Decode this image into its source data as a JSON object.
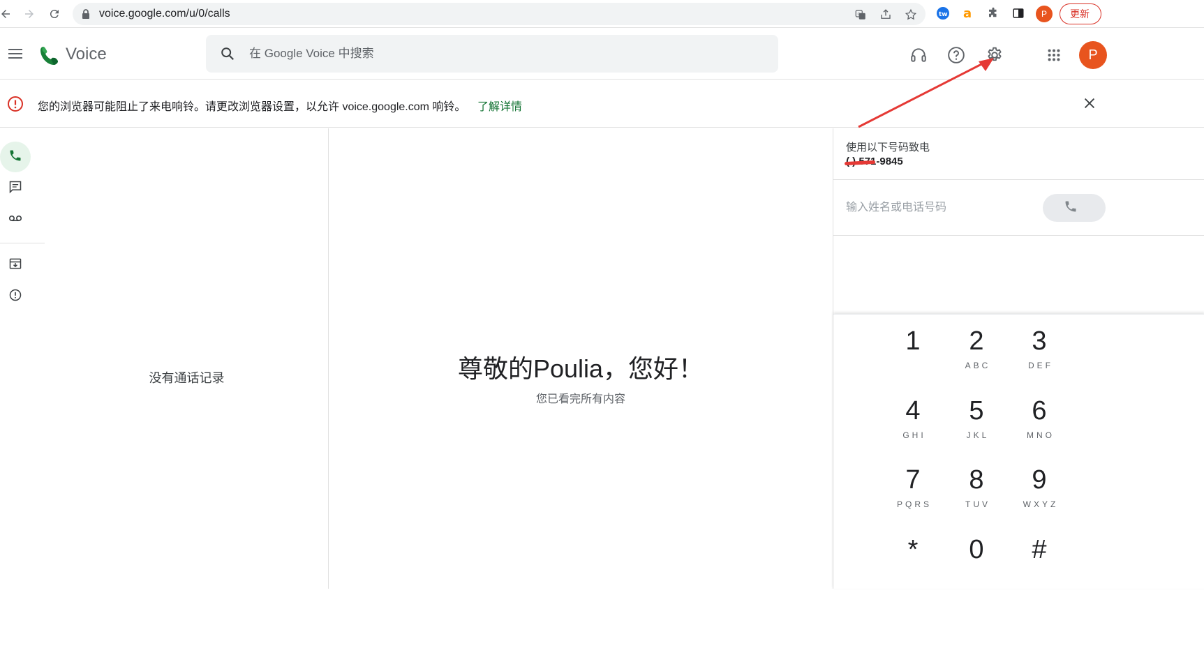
{
  "browser": {
    "url": "voice.google.com/u/0/calls",
    "profile_initial": "P",
    "update_label": "更新"
  },
  "header": {
    "app_title": "Voice",
    "search_placeholder": "在 Google Voice 中搜索",
    "avatar_initial": "P"
  },
  "banner": {
    "message": "您的浏览器可能阻止了来电响铃。请更改浏览器设置，以允许 voice.google.com 响铃。",
    "link": "了解详情"
  },
  "call_list": {
    "empty_text": "没有通话记录"
  },
  "main": {
    "greeting": "尊敬的Poulia，您好！",
    "subtext": "您已看完所有内容"
  },
  "dialer": {
    "from_label": "使用以下号码致电",
    "from_number": "(    ) 571-9845",
    "input_placeholder": "输入姓名或电话号码",
    "keys": [
      {
        "digit": "1",
        "letters": ""
      },
      {
        "digit": "2",
        "letters": "ABC"
      },
      {
        "digit": "3",
        "letters": "DEF"
      },
      {
        "digit": "4",
        "letters": "GHI"
      },
      {
        "digit": "5",
        "letters": "JKL"
      },
      {
        "digit": "6",
        "letters": "MNO"
      },
      {
        "digit": "7",
        "letters": "PQRS"
      },
      {
        "digit": "8",
        "letters": "TUV"
      },
      {
        "digit": "9",
        "letters": "WXYZ"
      },
      {
        "digit": "*",
        "letters": ""
      },
      {
        "digit": "0",
        "letters": ""
      },
      {
        "digit": "#",
        "letters": ""
      }
    ]
  },
  "colors": {
    "accent_green": "#137333",
    "warning_red": "#d93025",
    "avatar_orange": "#e8541e"
  }
}
